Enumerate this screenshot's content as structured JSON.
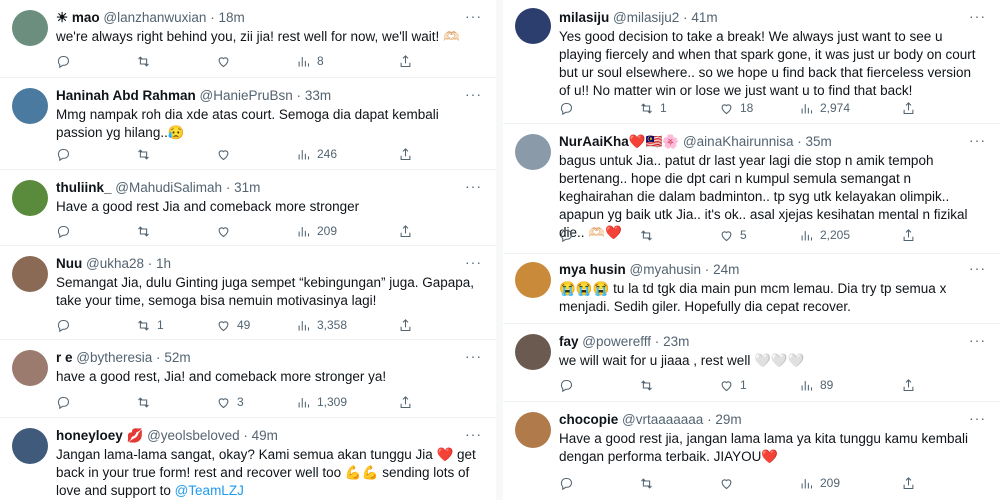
{
  "left": [
    {
      "name": "☀ mao",
      "handle": "@lanzhanwuxian",
      "time": "18m",
      "text": "we're always right behind you, zii jia! rest well for now, we'll wait! 🫶🏻",
      "reply": "",
      "retweets": "",
      "likes": "",
      "views": "8",
      "avatar_color": "#6b8e7f"
    },
    {
      "name": "Haninah Abd Rahman",
      "handle": "@HaniePruBsn",
      "time": "33m",
      "text": "Mmg nampak roh dia xde atas court. Semoga dia dapat kembali passion yg hilang..😥",
      "reply": "",
      "retweets": "",
      "likes": "",
      "views": "246",
      "avatar_color": "#4a7aa0"
    },
    {
      "name": "thuliink_",
      "handle": "@MahudiSalimah",
      "time": "31m",
      "text": "Have a good rest Jia and comeback more stronger",
      "reply": "",
      "retweets": "",
      "likes": "",
      "views": "209",
      "avatar_color": "#5a8a3c"
    },
    {
      "name": "Nuu",
      "handle": "@ukha28",
      "time": "1h",
      "text": "Semangat Jia, dulu Ginting juga sempet “kebingungan” juga. Gapapa, take your time, semoga bisa nemuin motivasinya lagi!",
      "reply": "",
      "retweets": "1",
      "likes": "49",
      "views": "3,358",
      "avatar_color": "#8b6a55"
    },
    {
      "name": "r e",
      "handle": "@bytheresia",
      "time": "52m",
      "text": "have a good rest, Jia! and comeback more stronger ya!",
      "reply": "",
      "retweets": "",
      "likes": "3",
      "views": "1,309",
      "avatar_color": "#9a7b6e"
    },
    {
      "name": "honeyloey 💋",
      "handle": "@yeolsbeloved",
      "time": "49m",
      "text": "Jangan lama-lama sangat, okay? Kami semua akan tunggu Jia ❤️ get back in your true form! rest and recover well too 💪💪 sending lots of love and support to ",
      "mention": "@TeamLZJ",
      "avatar_color": "#3f5a7a"
    }
  ],
  "right": [
    {
      "name": "milasiju",
      "handle": "@milasiju2",
      "time": "41m",
      "text": "Yes good decision to take a break! We always just want to see u playing fiercely and when that spark gone, it was just ur body on court but ur soul elsewhere.. so we hope u find back that fierceless version of u!! No matter win or lose we just want u to find that back!",
      "reply": "",
      "retweets": "1",
      "likes": "18",
      "views": "2,974",
      "avatar_color": "#2c3e6e"
    },
    {
      "name": "NurAaiKha❤️🇲🇾🌸",
      "handle": "@ainaKhairunnisa",
      "time": "35m",
      "text": "bagus untuk Jia.. patut dr last year lagi die stop n amik tempoh bertenang.. hope die dpt cari n kumpul semula semangat n keghairahan die dalam badminton.. tp syg utk kelayakan olimpik.. apapun yg baik utk Jia.. it's ok.. asal xjejas kesihatan mental n fizikal die.. 🫶🏻❤️",
      "reply": "",
      "retweets": "",
      "likes": "5",
      "views": "2,205",
      "avatar_color": "#8a9aa8"
    },
    {
      "name": "mya husin",
      "handle": "@myahusin",
      "time": "24m",
      "text": "😭😭😭 tu la td tgk dia main pun mcm lemau. Dia try tp semua x menjadi. Sedih giler. Hopefully dia cepat recover.",
      "avatar_color": "#c98a3a"
    },
    {
      "name": "fay",
      "handle": "@powerefff",
      "time": "23m",
      "text": "we will wait for u jiaaa , rest well 🤍🤍🤍",
      "reply": "",
      "retweets": "",
      "likes": "1",
      "views": "89",
      "avatar_color": "#6a5a50"
    },
    {
      "name": "chocopie",
      "handle": "@vrtaaaaaaa",
      "time": "29m",
      "text": "Have a good rest jia, jangan lama lama ya kita tunggu kamu kembali dengan performa terbaik. JIAYOU❤️",
      "reply": "",
      "retweets": "",
      "likes": "",
      "views": "209",
      "avatar_color": "#b07a4a"
    }
  ],
  "icons": {
    "more": "more-icon",
    "reply": "reply-icon",
    "retweet": "retweet-icon",
    "like": "like-icon",
    "views": "views-icon",
    "share": "share-icon"
  }
}
